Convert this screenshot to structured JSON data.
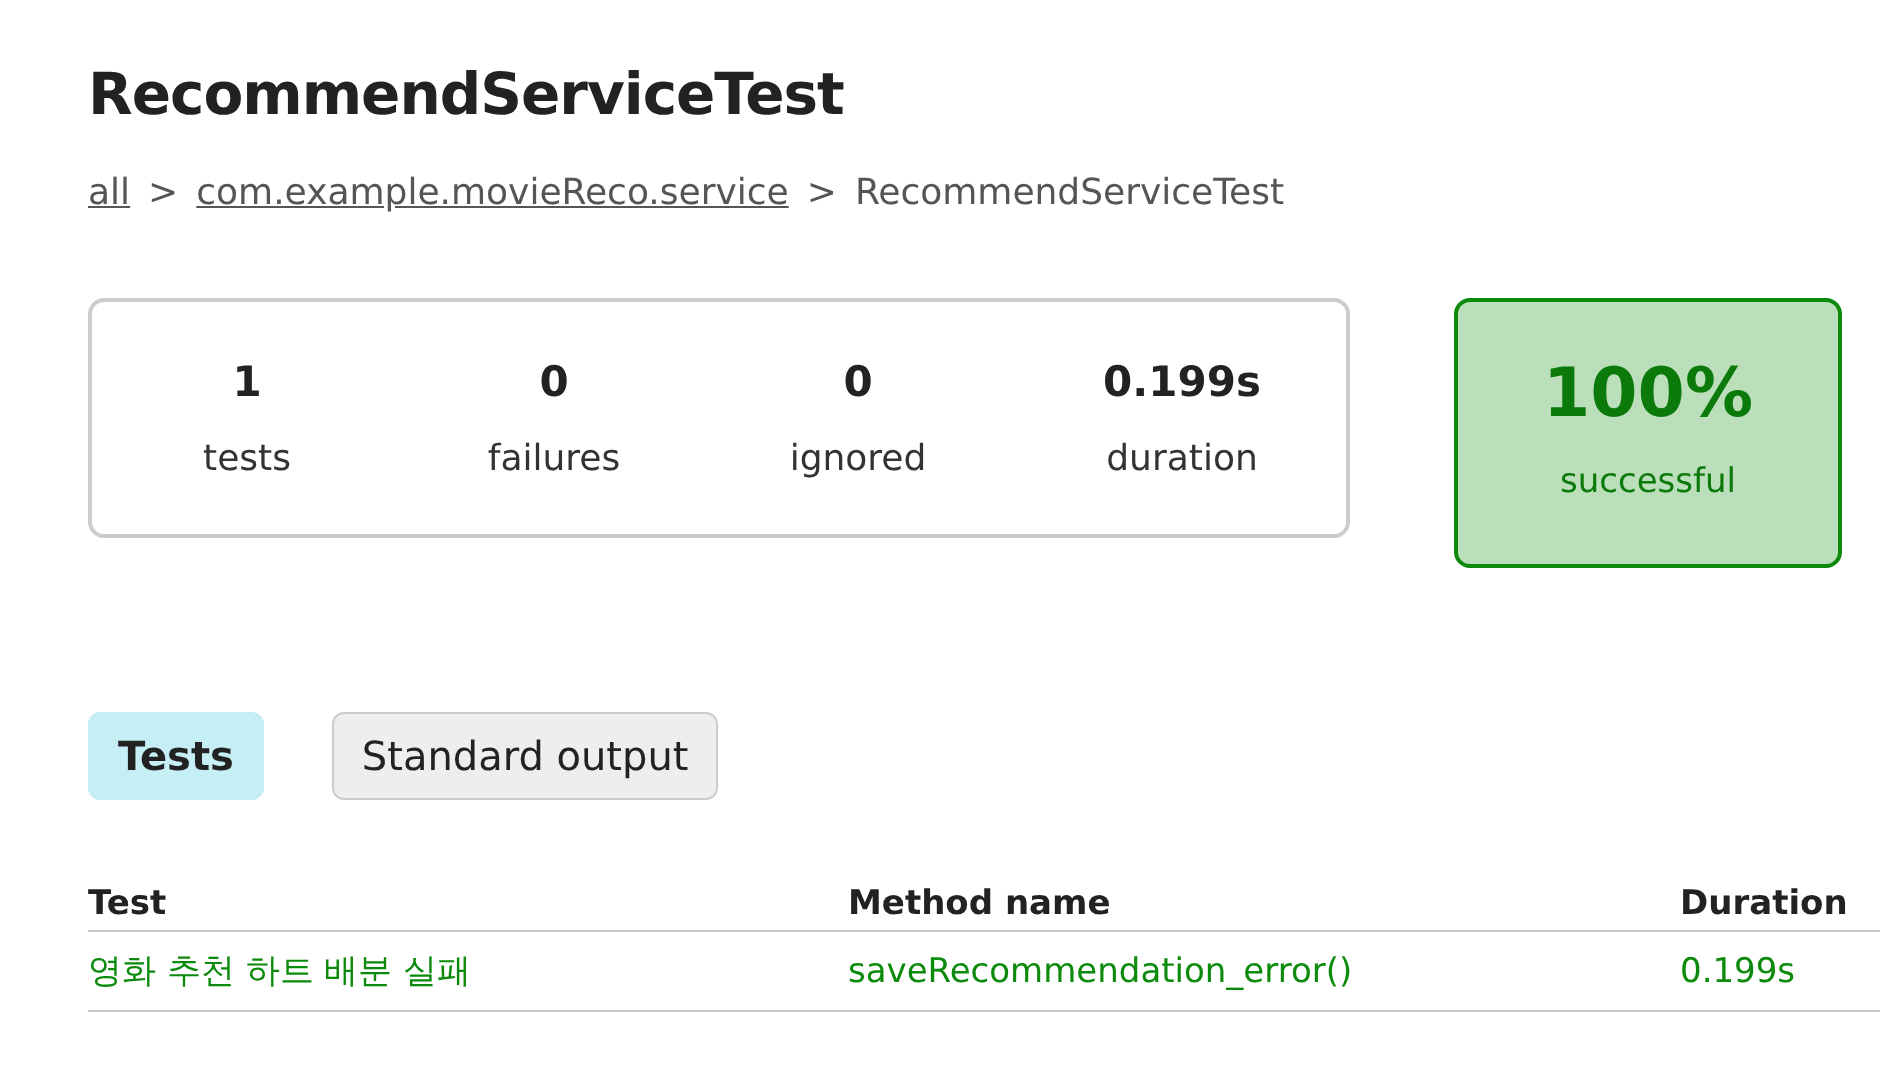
{
  "title": "RecommendServiceTest",
  "breadcrumb": [
    {
      "text": "all",
      "kind": "link"
    },
    {
      "text": ">",
      "kind": "separator"
    },
    {
      "text": "com.example.movieReco.service",
      "kind": "link"
    },
    {
      "text": ">",
      "kind": "separator"
    },
    {
      "text": "RecommendServiceTest",
      "kind": "current"
    }
  ],
  "counters": [
    {
      "value": "1",
      "label": "tests"
    },
    {
      "value": "0",
      "label": "failures"
    },
    {
      "value": "0",
      "label": "ignored"
    },
    {
      "value": "0.199s",
      "label": "duration"
    }
  ],
  "success_rate": {
    "value": "100%",
    "label": "successful",
    "passed": true
  },
  "tabs": [
    {
      "label": "Tests",
      "selected": true
    },
    {
      "label": "Standard output",
      "selected": false
    }
  ],
  "table": {
    "columns": [
      "Test",
      "Method name",
      "Duration"
    ],
    "rows": [
      {
        "cells": [
          "영화 추천 하트 배분 실패",
          "saveRecommendation_error()",
          "0.199s"
        ],
        "passed": true
      }
    ]
  }
}
